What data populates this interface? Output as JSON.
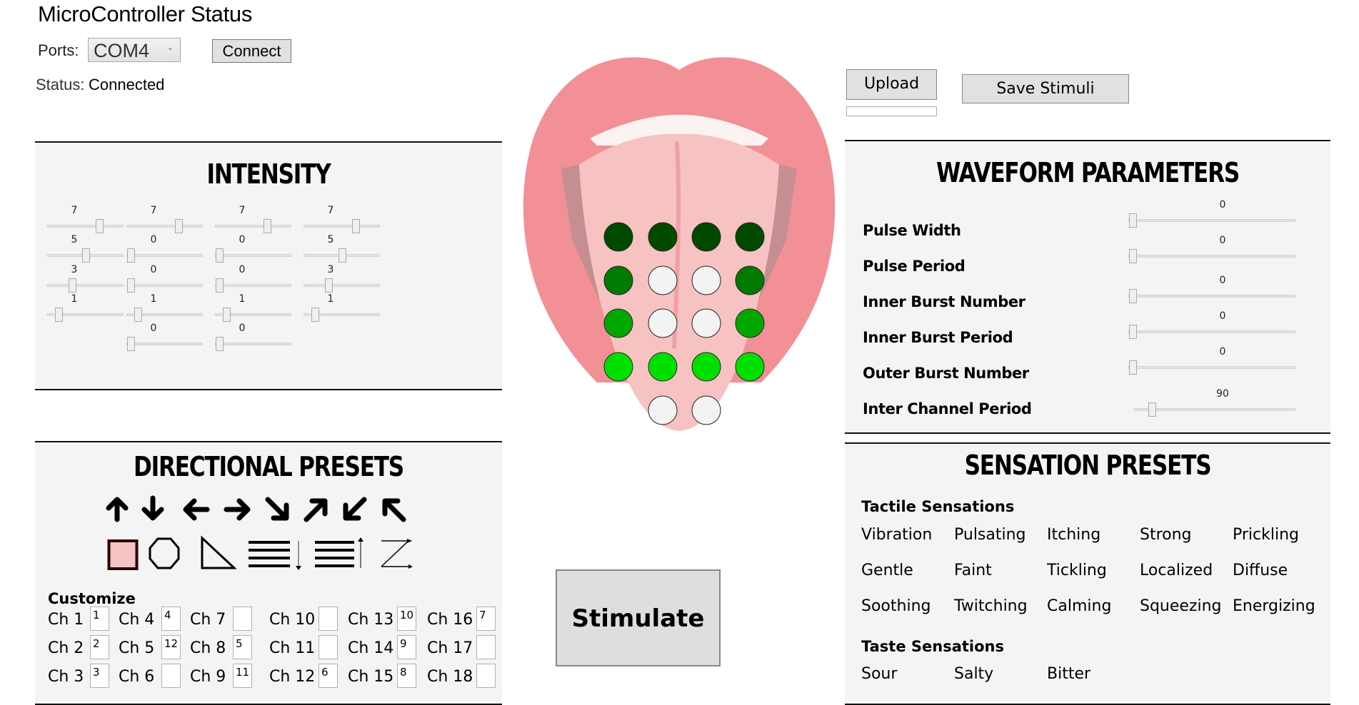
{
  "microcontroller": {
    "title": "MicroController Status",
    "ports_label": "Ports:",
    "port_selected": "COM4",
    "connect_label": "Connect",
    "status_label": "Status:",
    "status_value": "Connected"
  },
  "intensity": {
    "title": "INTENSITY",
    "max": 10,
    "sliders": [
      {
        "row": 1,
        "col": 1,
        "value": 7
      },
      {
        "row": 1,
        "col": 2,
        "value": 7
      },
      {
        "row": 1,
        "col": 3,
        "value": 7
      },
      {
        "row": 1,
        "col": 4,
        "value": 7
      },
      {
        "row": 2,
        "col": 1,
        "value": 5
      },
      {
        "row": 2,
        "col": 2,
        "value": 0
      },
      {
        "row": 2,
        "col": 3,
        "value": 0
      },
      {
        "row": 2,
        "col": 4,
        "value": 5
      },
      {
        "row": 3,
        "col": 1,
        "value": 3
      },
      {
        "row": 3,
        "col": 2,
        "value": 0
      },
      {
        "row": 3,
        "col": 3,
        "value": 0
      },
      {
        "row": 3,
        "col": 4,
        "value": 3
      },
      {
        "row": 4,
        "col": 1,
        "value": 1
      },
      {
        "row": 4,
        "col": 2,
        "value": 1
      },
      {
        "row": 4,
        "col": 3,
        "value": 1
      },
      {
        "row": 4,
        "col": 4,
        "value": 1
      },
      {
        "row": 5,
        "col": 2,
        "value": 0
      },
      {
        "row": 5,
        "col": 3,
        "value": 0
      }
    ]
  },
  "electrodes": {
    "colors": {
      "off": "#f3f3f3",
      "level_1": "#00e000",
      "level_3": "#00a800",
      "level_5": "#007a00",
      "level_7": "#004a00"
    },
    "grid": [
      [
        7,
        7,
        7,
        7
      ],
      [
        5,
        0,
        0,
        5
      ],
      [
        3,
        0,
        0,
        3
      ],
      [
        1,
        1,
        1,
        1
      ],
      [
        null,
        0,
        0,
        null
      ]
    ]
  },
  "upload": {
    "upload_label": "Upload",
    "progress": 0,
    "save_label": "Save Stimuli"
  },
  "stimulate_label": "Stimulate",
  "waveform": {
    "title": "WAVEFORM PARAMETERS",
    "params": [
      {
        "label": "Pulse Width",
        "value": 0,
        "fraction": 0.0
      },
      {
        "label": "Pulse Period",
        "value": 0,
        "fraction": 0.0
      },
      {
        "label": "Inner Burst Number",
        "value": 0,
        "fraction": 0.0
      },
      {
        "label": "Inner Burst Period",
        "value": 0,
        "fraction": 0.0
      },
      {
        "label": "Outer Burst Number",
        "value": 0,
        "fraction": 0.0
      },
      {
        "label": "Inter Channel Period",
        "value": 90,
        "fraction": 0.09
      }
    ]
  },
  "directional": {
    "title": "DIRECTIONAL PRESETS",
    "arrows": [
      "arrow-up-icon",
      "arrow-down-icon",
      "arrow-left-icon",
      "arrow-right-icon",
      "arrow-down-right-icon",
      "arrow-up-right-icon",
      "arrow-down-left-icon",
      "arrow-up-left-icon"
    ],
    "shapes": [
      "square-icon",
      "octagon-icon",
      "triangle-icon",
      "lines-sweep-down-icon",
      "lines-sweep-up-icon",
      "z-pattern-icon"
    ],
    "selected_shape": "square-icon",
    "selected_color": "#f4c4c4",
    "customize_label": "Customize",
    "channels": [
      {
        "label": "Ch 1",
        "value": "1"
      },
      {
        "label": "Ch 2",
        "value": "2"
      },
      {
        "label": "Ch 3",
        "value": "3"
      },
      {
        "label": "Ch 4",
        "value": "4"
      },
      {
        "label": "Ch 5",
        "value": "12"
      },
      {
        "label": "Ch 6",
        "value": ""
      },
      {
        "label": "Ch 7",
        "value": ""
      },
      {
        "label": "Ch 8",
        "value": "5"
      },
      {
        "label": "Ch 9",
        "value": "11"
      },
      {
        "label": "Ch 10",
        "value": ""
      },
      {
        "label": "Ch 11",
        "value": ""
      },
      {
        "label": "Ch 12",
        "value": "6"
      },
      {
        "label": "Ch 13",
        "value": "10"
      },
      {
        "label": "Ch 14",
        "value": "9"
      },
      {
        "label": "Ch 15",
        "value": "8"
      },
      {
        "label": "Ch 16",
        "value": "7"
      },
      {
        "label": "Ch 17",
        "value": ""
      },
      {
        "label": "Ch 18",
        "value": ""
      }
    ]
  },
  "sensation": {
    "title": "SENSATION PRESETS",
    "tactile_label": "Tactile Sensations",
    "tactile": [
      [
        "Vibration",
        "Pulsating",
        "Itching",
        "Strong",
        "Prickling"
      ],
      [
        "Gentle",
        "Faint",
        "Tickling",
        "Localized",
        "Diffuse"
      ],
      [
        "Soothing",
        "Twitching",
        "Calming",
        "Squeezing",
        "Energizing"
      ]
    ],
    "taste_label": "Taste Sensations",
    "taste": [
      "Sour",
      "Salty",
      "Bitter"
    ]
  }
}
